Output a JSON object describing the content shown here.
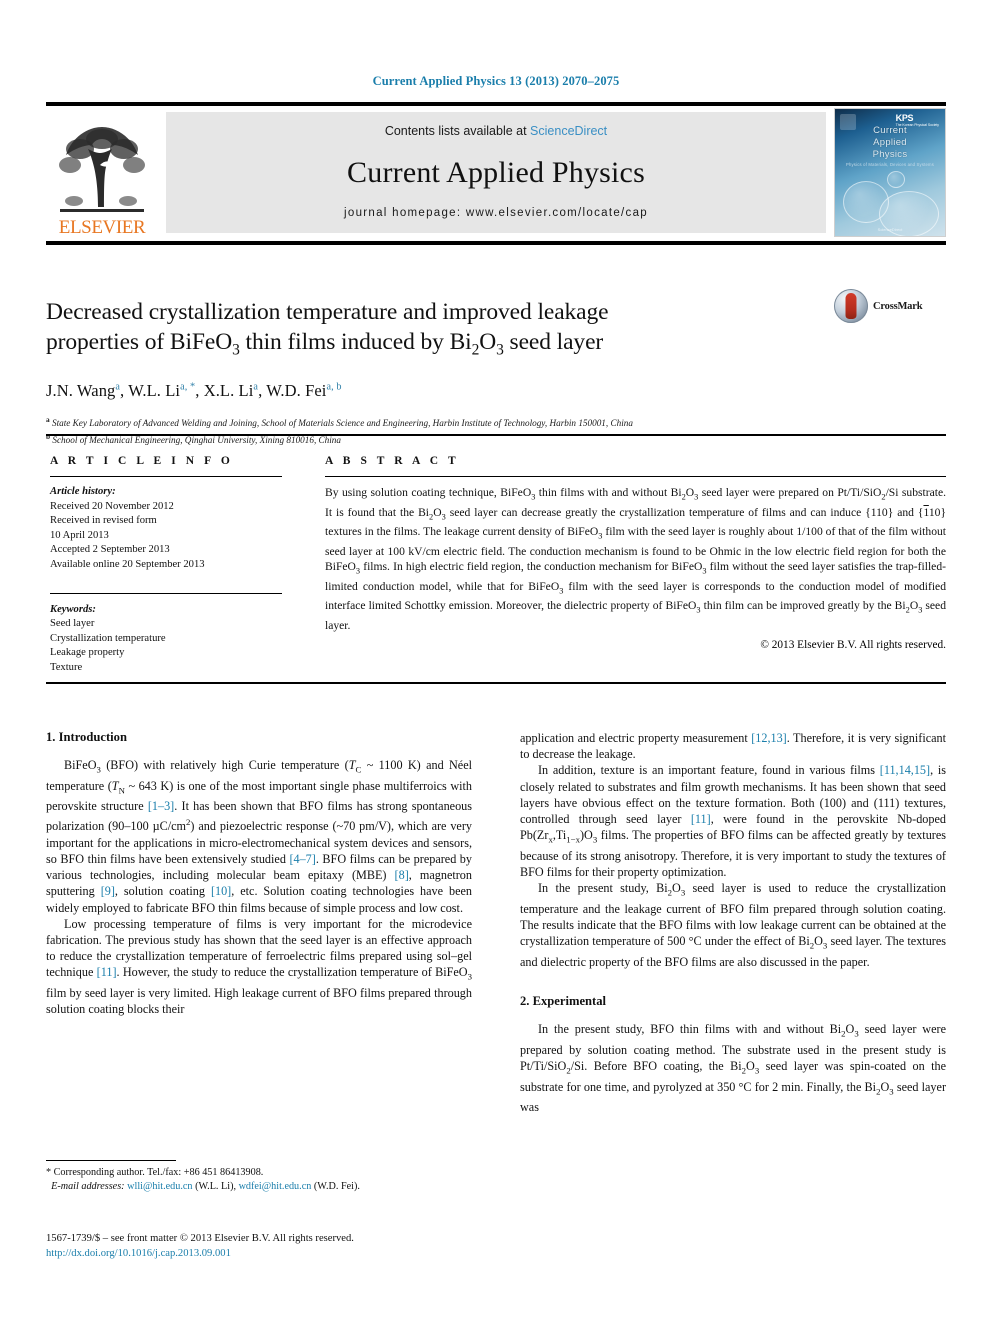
{
  "running_head": "Current Applied Physics 13 (2013) 2070–2075",
  "journal_header": {
    "publisher_wordmark": "ELSEVIER",
    "contents_prefix": "Contents lists available at ",
    "contents_link": "ScienceDirect",
    "journal_title": "Current Applied Physics",
    "homepage": "journal homepage: www.elsevier.com/locate/cap",
    "cover": {
      "line1": "Current",
      "line2": "Applied",
      "line3": "Physics",
      "subtitle": "Physics of Materials, Devices and Systems",
      "society": "KPS",
      "society_sub": "The Korean Physical Society",
      "footer": "ScienceDirect"
    }
  },
  "article": {
    "title_line1_a": "Decreased crystallization temperature and improved leakage",
    "title_line2_a": "properties of BiFeO",
    "title_line2_sub1": "3",
    "title_line2_b": " thin films induced by Bi",
    "title_line2_sub2": "2",
    "title_line2_c": "O",
    "title_line2_sub3": "3",
    "title_line2_d": " seed layer",
    "crossmark_label": "CrossMark",
    "authors_plain": "J.N. Wang a, W.L. Li a,*, X.L. Li a, W.D. Fei a, b",
    "authors": [
      {
        "name": "J.N. Wang",
        "sup": "a"
      },
      {
        "name": "W.L. Li",
        "sup": "a, *"
      },
      {
        "name": "X.L. Li",
        "sup": "a"
      },
      {
        "name": "W.D. Fei",
        "sup": "a, b"
      }
    ],
    "affiliations": [
      {
        "marker": "a",
        "text": "State Key Laboratory of Advanced Welding and Joining, School of Materials Science and Engineering, Harbin Institute of Technology, Harbin 150001, China"
      },
      {
        "marker": "b",
        "text": "School of Mechanical Engineering, Qinghai University, Xining 810016, China"
      }
    ]
  },
  "article_info": {
    "heading": "A R T I C L E  I N F O",
    "history_label": "Article history:",
    "history": [
      "Received 20 November 2012",
      "Received in revised form",
      "10 April 2013",
      "Accepted 2 September 2013",
      "Available online 20 September 2013"
    ],
    "keywords_label": "Keywords:",
    "keywords": [
      "Seed layer",
      "Crystallization temperature",
      "Leakage property",
      "Texture"
    ]
  },
  "abstract": {
    "heading": "A B S T R A C T",
    "copyright": "© 2013 Elsevier B.V. All rights reserved."
  },
  "sections": {
    "introduction_heading": "1. Introduction",
    "experimental_heading": "2. Experimental"
  },
  "footnote": {
    "corresponding": "* Corresponding author. Tel./fax: +86 451 86413908.",
    "email_label": "E-mail addresses:",
    "email1": "wlli@hit.edu.cn",
    "email1_who": "(W.L. Li)",
    "email2": "wdfei@hit.edu.cn",
    "email2_who": "(W.D. Fei)."
  },
  "footer": {
    "issn_line": "1567-1739/$ – see front matter © 2013 Elsevier B.V. All rights reserved.",
    "doi": "http://dx.doi.org/10.1016/j.cap.2013.09.001"
  },
  "colors": {
    "link_teal": "#1a7eab",
    "sciencedirect_blue": "#3a8fc4",
    "elsevier_orange": "#e87722",
    "author_sup_blue": "#2e7fa8"
  }
}
